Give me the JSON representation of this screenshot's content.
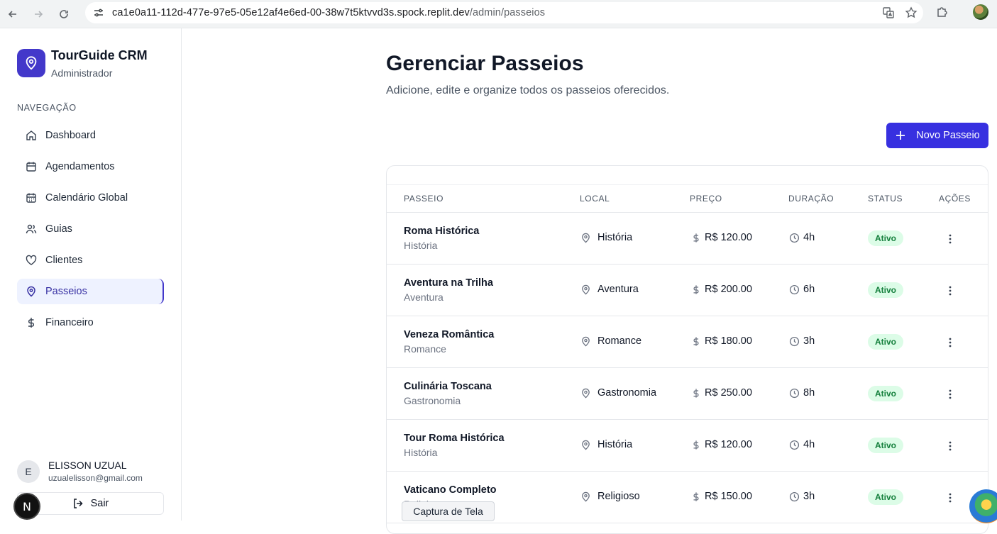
{
  "browser": {
    "url_host": "ca1e0a11-112d-477e-97e5-05e12af4e6ed-00-38w7t5ktvvd3s.spock.replit.dev",
    "url_path": "/admin/passeios"
  },
  "sidebar": {
    "brand_title": "TourGuide CRM",
    "brand_subtitle": "Administrador",
    "nav_heading": "NAVEGAÇÃO",
    "items": [
      {
        "label": "Dashboard",
        "icon": "home-icon"
      },
      {
        "label": "Agendamentos",
        "icon": "calendar-icon"
      },
      {
        "label": "Calendário Global",
        "icon": "calendar-days-icon"
      },
      {
        "label": "Guias",
        "icon": "users-icon"
      },
      {
        "label": "Clientes",
        "icon": "heart-icon"
      },
      {
        "label": "Passeios",
        "icon": "map-pin-icon",
        "active": true
      },
      {
        "label": "Financeiro",
        "icon": "dollar-icon"
      }
    ],
    "user": {
      "initial": "E",
      "name": "ELISSON UZUAL",
      "email": "uzualelisson@gmail.com"
    },
    "logout_label": "Sair",
    "dev_badge": "N"
  },
  "main": {
    "title": "Gerenciar Passeios",
    "subtitle": "Adicione, edite e organize todos os passeios oferecidos.",
    "new_button_label": "Novo Passeio",
    "table": {
      "columns": [
        "PASSEIO",
        "LOCAL",
        "PREÇO",
        "DURAÇÃO",
        "STATUS",
        "AÇÕES"
      ],
      "rows": [
        {
          "name": "Roma Histórica",
          "category": "História",
          "local": "História",
          "price": "R$ 120.00",
          "duration": "4h",
          "status": "Ativo"
        },
        {
          "name": "Aventura na Trilha",
          "category": "Aventura",
          "local": "Aventura",
          "price": "R$ 200.00",
          "duration": "6h",
          "status": "Ativo"
        },
        {
          "name": "Veneza Romântica",
          "category": "Romance",
          "local": "Romance",
          "price": "R$ 180.00",
          "duration": "3h",
          "status": "Ativo"
        },
        {
          "name": "Culinária Toscana",
          "category": "Gastronomia",
          "local": "Gastronomia",
          "price": "R$ 250.00",
          "duration": "8h",
          "status": "Ativo"
        },
        {
          "name": "Tour Roma Histórica",
          "category": "História",
          "local": "História",
          "price": "R$ 120.00",
          "duration": "4h",
          "status": "Ativo"
        },
        {
          "name": "Vaticano Completo",
          "category": "Religioso",
          "local": "Religioso",
          "price": "R$ 150.00",
          "duration": "3h",
          "status": "Ativo"
        }
      ]
    }
  },
  "tooltip": "Captura de Tela",
  "colors": {
    "accent": "#4338ca",
    "button": "#3730e0",
    "status_bg": "#dcfce7",
    "status_text": "#15803d"
  }
}
